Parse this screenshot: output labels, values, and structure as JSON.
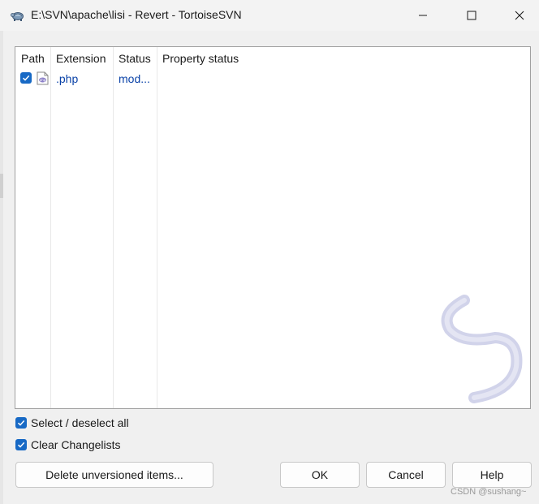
{
  "window": {
    "title": "E:\\SVN\\apache\\lisi - Revert - TortoiseSVN",
    "app_icon": "tortoisesvn-turtle-icon",
    "controls": [
      "minimize-icon",
      "maximize-icon",
      "close-icon"
    ]
  },
  "file_list": {
    "columns": [
      "Path",
      "Extension",
      "Status",
      "Property status"
    ],
    "rows": [
      {
        "checked": true,
        "path": "",
        "file_icon": "php-file-icon",
        "extension": ".php",
        "status": "mod...",
        "property_status": ""
      }
    ]
  },
  "options": {
    "select_all": {
      "label": "Select / deselect all",
      "checked": true
    },
    "clear_changelists": {
      "label": "Clear Changelists",
      "checked": true
    }
  },
  "buttons": {
    "delete_unversioned": "Delete unversioned items...",
    "ok": "OK",
    "cancel": "Cancel",
    "help": "Help"
  },
  "watermark_text": "CSDN @sushang~",
  "colors": {
    "accent": "#1769c5",
    "link_text": "#0b43a8",
    "background": "#f0f0f0"
  }
}
